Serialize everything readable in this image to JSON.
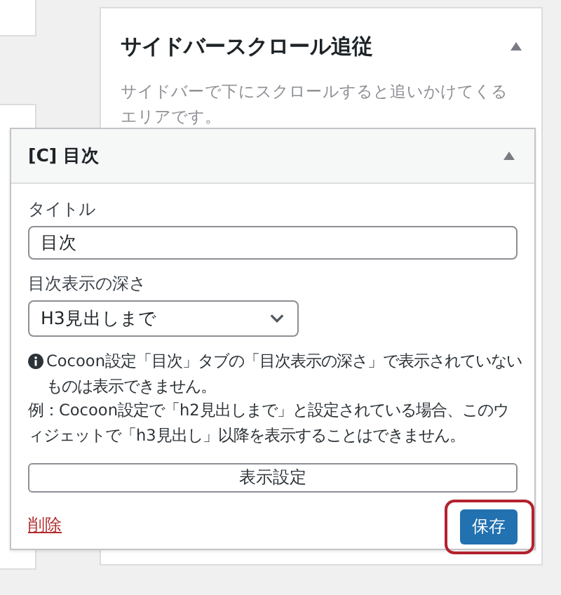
{
  "sidebar_area": {
    "title": "サイドバースクロール追従",
    "description": "サイドバーで下にスクロールすると追いかけてくるエリアです。",
    "expanded": true
  },
  "widget": {
    "title": "[C] 目次",
    "expanded": true,
    "fields": [
      {
        "kind": "text",
        "label": "タイトル",
        "value": "目次"
      },
      {
        "kind": "select",
        "label": "目次表示の深さ",
        "value": "H3見出しまで"
      }
    ],
    "notes": [
      "Cocoon設定「目次」タブの「目次表示の深さ」で表示されていないものは表示できません。",
      "例：Cocoon設定で「h2見出しまで」と設定されている場合、このウィジェットで「h3見出し」以降を表示することはできません。"
    ],
    "display_button": "表示設定",
    "delete_link": "削除",
    "save_button": {
      "label": "保存",
      "highlighted": true
    }
  }
}
